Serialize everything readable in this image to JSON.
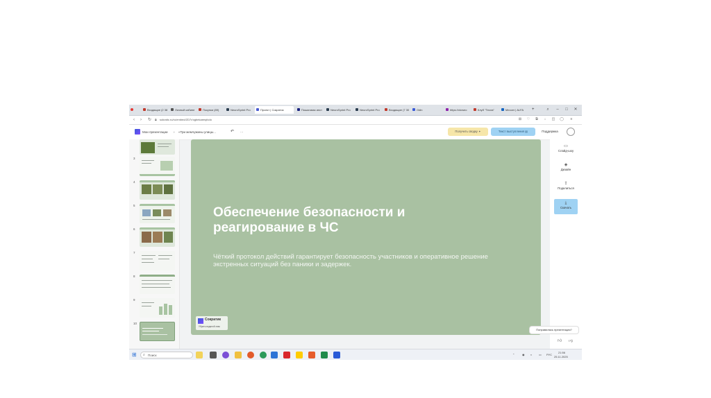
{
  "browser": {
    "tabs": [
      {
        "label": "Входящие (2 38",
        "color": "#c0392b"
      },
      {
        "label": "Личный кабине",
        "color": "#555555"
      },
      {
        "label": "Покупки (89)",
        "color": "#c0392b"
      },
      {
        "label": "NeuroSprint Pro",
        "color": "#2c3e50"
      },
      {
        "label": "Проект | Сократик",
        "color": "#4a5bd1"
      },
      {
        "label": "Пошаговая инст",
        "color": "#1a237e"
      },
      {
        "label": "NeuroSprint Pro",
        "color": "#2c3e50"
      },
      {
        "label": "NeuroSprint Pro",
        "color": "#2c3e50"
      },
      {
        "label": "Входящие (7 30",
        "color": "#c0392b"
      },
      {
        "label": "Odin",
        "color": "#3b5bd6"
      },
      {
        "label": "https://vkvseo",
        "color": "#8e24aa"
      },
      {
        "label": "Клуб \"Тесла\"",
        "color": "#c0392b"
      },
      {
        "label": "Мессеr | ALFA",
        "color": "#1565c0"
      }
    ],
    "new_tab": "+",
    "url": "sokratic.ru/ru/embed/ZD7r/ogbekaeeqfcdo"
  },
  "header": {
    "breadcrumb_root": "Мои презентации",
    "separator": "›",
    "breadcrumb_current": "«Три жемчужины улицы...",
    "undo": "↶",
    "more": "···",
    "summary_button": "Получить сводку",
    "speech_button": "Текст выступления",
    "support_link": "Поддержка"
  },
  "thumbnails": [
    {
      "num": "",
      "style": "photo"
    },
    {
      "num": "3",
      "style": "text"
    },
    {
      "num": "4",
      "style": "photo"
    },
    {
      "num": "5",
      "style": "photo"
    },
    {
      "num": "6",
      "style": "photo"
    },
    {
      "num": "7",
      "style": "text"
    },
    {
      "num": "8",
      "style": "text"
    },
    {
      "num": "9",
      "style": "chart"
    },
    {
      "num": "10",
      "style": "title"
    }
  ],
  "slide": {
    "title": "Обеспечение безопасности и реагирование в ЧС",
    "subtitle": "Чёткий протокол действий гарантирует безопасность участников и оперативное решение экстренных ситуаций без паники и задержек.",
    "brand_name": "Сократик",
    "brand_tagline": "Убрать водяной знак",
    "background_color": "#a9c1a2"
  },
  "right_panel": {
    "slideshow": "Слайд-шоу",
    "design": "Дизайн",
    "share": "Поделиться",
    "download": "Скачать",
    "feedback": "Понравилась презентация?"
  },
  "taskbar": {
    "search_label": "Поиск",
    "language": "РУС",
    "time": "21:56",
    "date": "25.11.2025"
  }
}
